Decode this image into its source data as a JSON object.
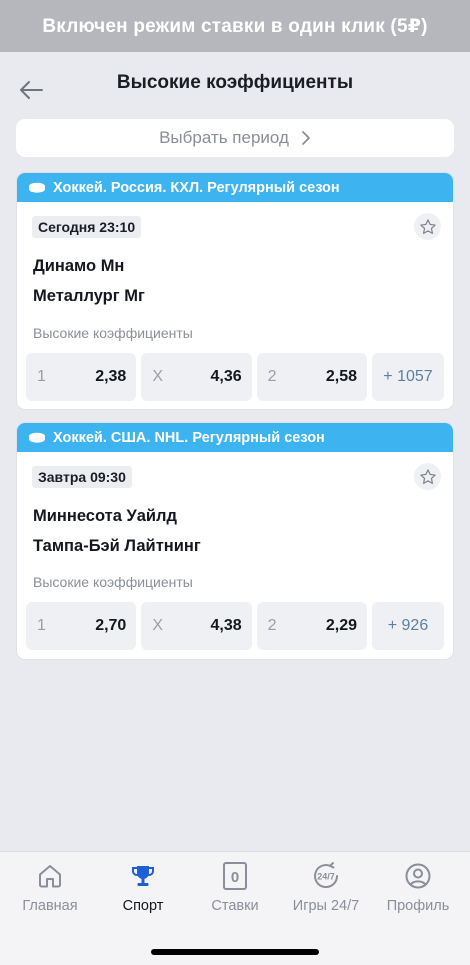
{
  "banner": {
    "text": "Включен режим ставки в один клик (5₽)"
  },
  "header": {
    "title": "Высокие коэффициенты",
    "back_icon": "arrow-left-icon"
  },
  "period": {
    "label": "Выбрать период",
    "icon": "chevron-right-icon"
  },
  "events": [
    {
      "league": "Хоккей. Россия. КХЛ. Регулярный сезон",
      "time": "Сегодня 23:10",
      "team1": "Динамо Мн",
      "team2": "Металлург Мг",
      "odds_title": "Высокие коэффициенты",
      "odds": [
        {
          "label": "1",
          "value": "2,38"
        },
        {
          "label": "X",
          "value": "4,36"
        },
        {
          "label": "2",
          "value": "2,58"
        }
      ],
      "more": "+ 1057"
    },
    {
      "league": "Хоккей. США. NHL. Регулярный сезон",
      "time": "Завтра 09:30",
      "team1": "Миннесота Уайлд",
      "team2": "Тампа-Бэй Лайтнинг",
      "odds_title": "Высокие коэффициенты",
      "odds": [
        {
          "label": "1",
          "value": "2,70"
        },
        {
          "label": "X",
          "value": "4,38"
        },
        {
          "label": "2",
          "value": "2,29"
        }
      ],
      "more": "+ 926"
    }
  ],
  "tabbar": {
    "items": [
      {
        "label": "Главная",
        "icon": "home-icon",
        "active": false
      },
      {
        "label": "Спорт",
        "icon": "trophy-icon",
        "active": true
      },
      {
        "label": "Ставки",
        "icon": "bet-slip-icon",
        "active": false,
        "badge": "0"
      },
      {
        "label": "Игры 24/7",
        "icon": "games-24-7-icon",
        "active": false,
        "badge": "24/7"
      },
      {
        "label": "Профиль",
        "icon": "profile-icon",
        "active": false
      }
    ]
  },
  "colors": {
    "accent": "#3db4ef",
    "banner": "#b6b7bd",
    "more_text": "#5b7fa3"
  }
}
